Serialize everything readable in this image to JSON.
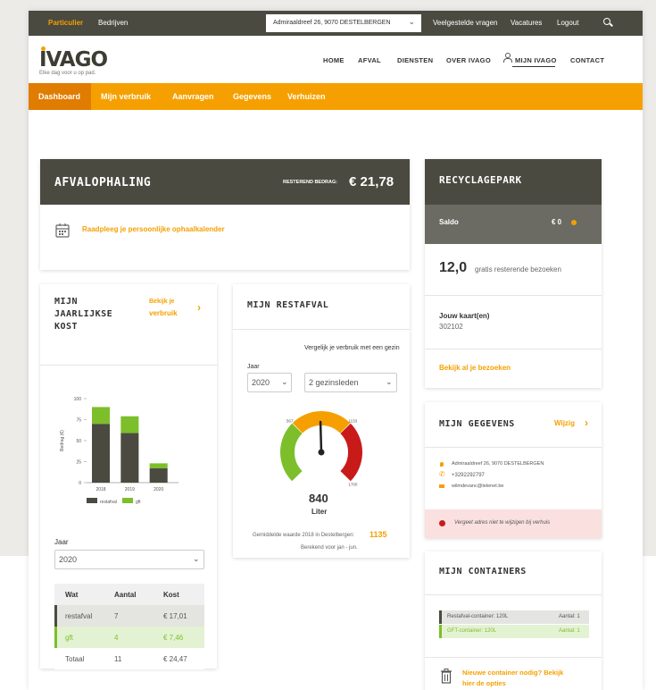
{
  "topbar": {
    "particulier": "Particulier",
    "bedrijven": "Bedrijven",
    "address": "Admiraaldreef 26, 9070 DESTELBERGEN",
    "faq": "Veelgestelde vragen",
    "vacatures": "Vacatures",
    "logout": "Logout"
  },
  "brand": {
    "logo": "IVAGO",
    "tagline": "Elke dag voor u op pad."
  },
  "nav": [
    "HOME",
    "AFVAL",
    "DIENSTEN",
    "OVER IVAGO",
    "MIJN IVAGO",
    "CONTACT"
  ],
  "subnav": [
    "Dashboard",
    "Mijn verbruik",
    "Aanvragen",
    "Gegevens",
    "Verhuizen"
  ],
  "afvalophaling": {
    "title": "AFVALOPHALING",
    "balance_label": "RESTEREND BEDRAG:",
    "balance_value": "€ 21,78",
    "calendar_link": "Raadpleeg je persoonlijke ophaalkalender"
  },
  "recyclagepark": {
    "title": "RECYCLAGEPARK",
    "saldo_label": "Saldo",
    "saldo_value": "€ 0",
    "visits_number": "12,0",
    "visits_text": "gratis resterende bezoeken",
    "cards_label": "Jouw kaart(en)",
    "cards_value": "302102",
    "visits_link": "Bekijk al je bezoeken"
  },
  "kost": {
    "title_line1": "MIJN",
    "title_line2": "JAARLIJKSE",
    "title_line3": "KOST",
    "link_line1": "Bekijk je",
    "link_line2": "verbruik",
    "year_label": "Jaar",
    "year_value": "2020",
    "table": {
      "headers": [
        "Wat",
        "Aantal",
        "Kost"
      ],
      "rows": [
        [
          "restafval",
          "7",
          "€ 17,01"
        ],
        [
          "gft",
          "4",
          "€ 7,46"
        ],
        [
          "Totaal",
          "11",
          "€ 24,47"
        ]
      ]
    }
  },
  "chart_data": {
    "type": "bar",
    "stacked": true,
    "categories": [
      "2018",
      "2019",
      "2020"
    ],
    "series": [
      {
        "name": "restafval",
        "values": [
          70,
          59,
          17
        ],
        "color": "#4a4a40"
      },
      {
        "name": "gft",
        "values": [
          20,
          20,
          6
        ],
        "color": "#7cbf2a"
      }
    ],
    "ylabel": "Bedrag (€)",
    "ylim": [
      0,
      100
    ],
    "yticks": [
      "0",
      "25",
      "50",
      "75",
      "100"
    ]
  },
  "restafval": {
    "title": "MIJN RESTAFVAL",
    "year_label": "Jaar",
    "year_value": "2020",
    "compare_label": "Vergelijk je verbruik met een gezin",
    "compare_value": "2 gezinsleden",
    "gauge_value": 840,
    "gauge_min": 0,
    "gauge_max": 1700,
    "gauge_ticks": [
      "567",
      "1133",
      "1700"
    ],
    "unit": "Liter",
    "average_text": "Gemiddelde waarde 2018 in Destelbergen:",
    "average_value": "1135",
    "period_text": "Berekend voor jan - jun."
  },
  "gegevens": {
    "title": "MIJN GEGEVENS",
    "edit_link": "Wijzig",
    "address": "Admiraaldreef 26, 9070 DESTELBERGEN",
    "phone": "+3292292797",
    "email": "wilmdevanc@telenet.be",
    "alert": "Vergeet adres niet te wijzigen bij verhuis"
  },
  "containers": {
    "title": "MIJN CONTAINERS",
    "items": [
      {
        "name": "Restafval-container: 120L",
        "count": "Aantal: 1"
      },
      {
        "name": "GFT-container: 120L",
        "count": "Aantal: 1"
      }
    ],
    "new_link_line1": "Nieuwe container nodig? Bekijk",
    "new_link_line2": "hier de opties"
  },
  "colors": {
    "accent": "#f5a000",
    "dark": "#4a4a40",
    "green": "#7cbf2a",
    "red": "#c91a1a"
  }
}
